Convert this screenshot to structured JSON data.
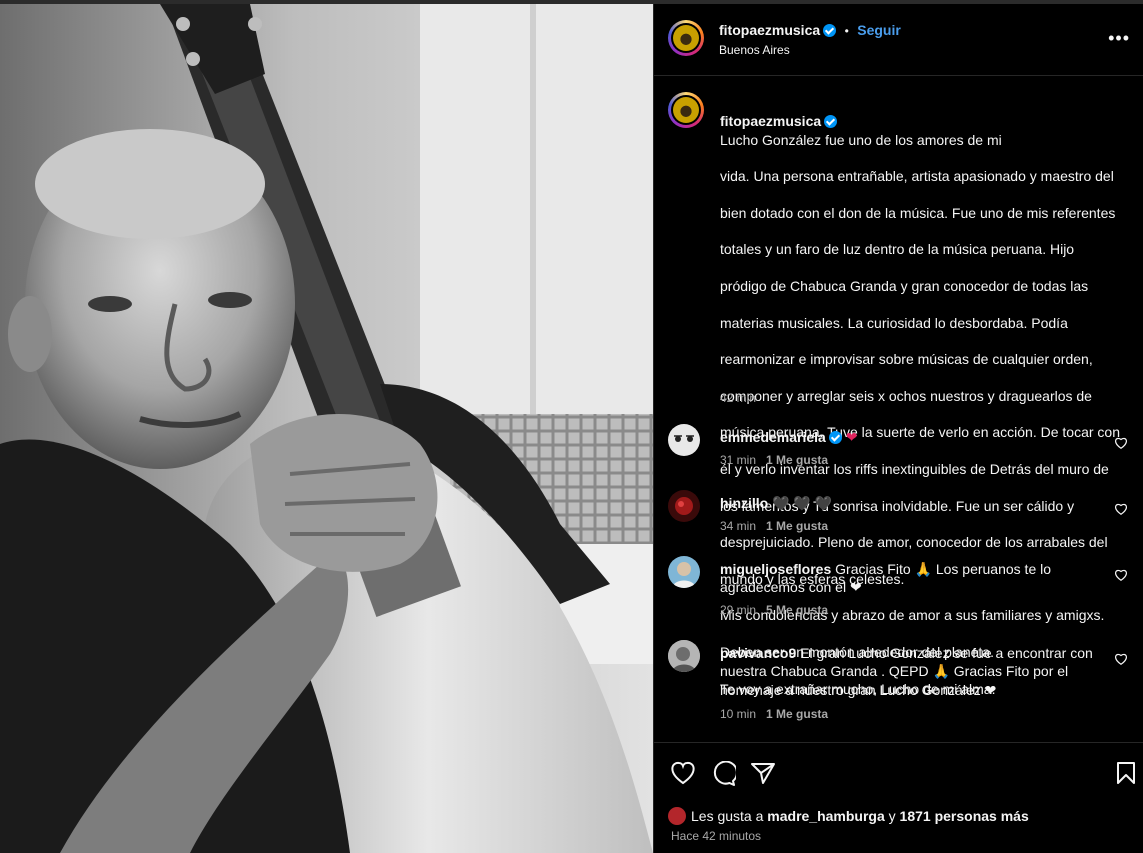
{
  "post": {
    "author": "fitopaezmusica",
    "follow_label": "Seguir",
    "location": "Buenos Aires",
    "more_icon": "more-horizontal-icon",
    "caption": "Lucho González fue uno de los amores de mi vida. Una persona entrañable, artista apasionado y maestro del bien dotado con el don de la música. Fue uno de mis referentes totales y un faro de luz dentro de la música peruana. Hijo pródigo de Chabuca Granda y gran conocedor de todas las materias musicales. La curiosidad lo desbordaba. Podía rearmonizar e improvisar sobre músicas de cualquier orden, componer y arreglar seis x ochos nuestros y draguearlos de música peruana. Tuve la suerte de verlo en acción. De tocar con él y verlo inventar los riffs inextinguibles de Detrás del muro de los lamentos y Tu sonrisa inolvidable. Fue un ser cálido y desprejuiciado. Pleno de amor, conocedor de los arrabales del mundo y las esferas celestes.",
    "caption_lines": [
      "Lucho González fue uno de los amores de mi",
      "vida. Una persona entrañable, artista apasionado y maestro del",
      "bien dotado con el don de la música. Fue uno de mis referentes",
      "totales y un faro de luz dentro de la música peruana. Hijo",
      "pródigo de Chabuca Granda y gran conocedor de todas las",
      "materias musicales. La curiosidad lo desbordaba. Podía",
      "rearmonizar e improvisar sobre músicas de cualquier orden,",
      "componer y arreglar seis x ochos nuestros y draguearlos de",
      "música peruana. Tuve la suerte de verlo en acción. De tocar con",
      "él y verlo inventar los riffs inextinguibles de Detrás del muro de",
      "los lamentos y Tu sonrisa inolvidable. Fue un ser cálido y",
      "desprejuiciado. Pleno de amor, conocedor de los arrabales del",
      "mundo y las esferas celestes.",
      "Mis condolencias y abrazo de amor a sus familiares y amigxs.",
      "Deben ser un montón alrededor del planeta.",
      "Te voy a extrañar mucho, Lucho de mi alma."
    ],
    "caption_time": "42 min"
  },
  "comments": [
    {
      "user": "emmedemariela",
      "verified": true,
      "lines": [
        "❤"
      ],
      "time": "31 min",
      "likes": "1 Me gusta",
      "avatar_color": "#e8e8e8"
    },
    {
      "user": "hinzillo",
      "verified": false,
      "lines": [
        "🖤 🖤 🖤"
      ],
      "time": "34 min",
      "likes": "1 Me gusta",
      "avatar_color": "#3a0a0a"
    },
    {
      "user": "migueljoseflores",
      "verified": false,
      "lines": [
        "Gracias Fito 🙏 Los peruanos te lo",
        "agradecemos con el ❤"
      ],
      "time": "29 min",
      "likes": "5 Me gusta",
      "avatar_color": "#7fb6d6"
    },
    {
      "user": "pavivanco9",
      "verified": false,
      "lines": [
        "El gran Lucho González se fue a encontrar con",
        "nuestra Chabuca Granda . QEPD 🙏 Gracias Fito por el",
        "homenaje a nuestro gran Lucho González ❤"
      ],
      "time": "10 min",
      "likes": "1 Me gusta",
      "avatar_color": "#9a9a9a"
    }
  ],
  "footer": {
    "likes_prefix": "Les gusta a",
    "likes_user": "madre_hamburga",
    "likes_middle": "y",
    "likes_rest": "1871 personas más",
    "time_ago": "Hace 42 minutos"
  },
  "colors": {
    "background": "#000000",
    "link_blue": "#4a9dec",
    "verified_blue": "#0095f6",
    "muted": "#a8a8a8",
    "heart_red": "#e0245e"
  }
}
